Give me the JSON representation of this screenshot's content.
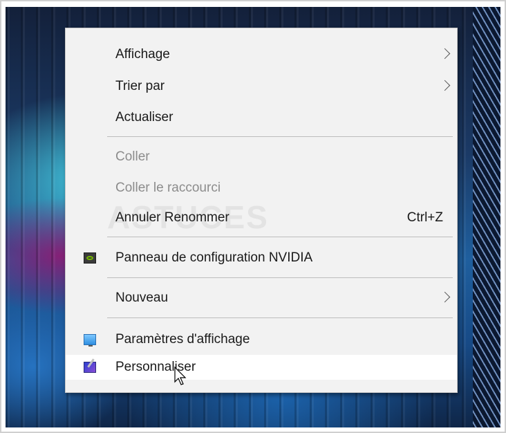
{
  "context_menu": {
    "items": [
      {
        "label": "Affichage",
        "submenu": true
      },
      {
        "label": "Trier par",
        "submenu": true
      },
      {
        "label": "Actualiser"
      },
      {
        "label": "Coller",
        "disabled": true
      },
      {
        "label": "Coller le raccourci",
        "disabled": true
      },
      {
        "label": "Annuler Renommer",
        "shortcut": "Ctrl+Z"
      },
      {
        "label": "Panneau de configuration NVIDIA",
        "icon": "nvidia-icon"
      },
      {
        "label": "Nouveau",
        "submenu": true
      },
      {
        "label": "Paramètres d'affichage",
        "icon": "display-settings-icon"
      },
      {
        "label": "Personnaliser",
        "icon": "personalize-icon",
        "hovered": true
      }
    ]
  },
  "watermark_text": "ASTUCES",
  "colors": {
    "menu_bg": "#f2f2f2",
    "hover_bg": "#ffffff",
    "disabled_text": "#8c8c8c",
    "nvidia_green": "#76b900"
  }
}
